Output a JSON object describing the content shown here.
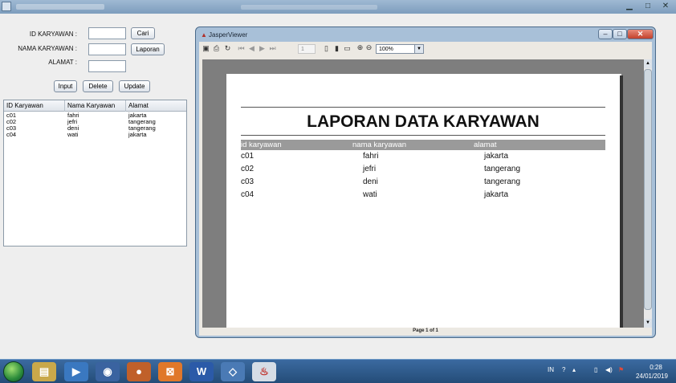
{
  "form": {
    "labels": [
      "ID KARYAWAN :",
      "NAMA KARYAWAN :",
      "ALAMAT :"
    ],
    "cari_label": "Cari",
    "laporan_label": "Laporan",
    "input_label": "Input",
    "delete_label": "Delete",
    "update_label": "Update"
  },
  "table": {
    "headers": [
      "ID Karyawan",
      "Nama Karyawan",
      "Alamat"
    ],
    "rows": [
      [
        "c01",
        "fahri",
        "jakarta"
      ],
      [
        "c02",
        "jefri",
        "tangerang"
      ],
      [
        "c03",
        "deni",
        "tangerang"
      ],
      [
        "c04",
        "wati",
        "jakarta"
      ]
    ]
  },
  "viewer": {
    "title": "JasperViewer",
    "page_input": "1",
    "zoom": "100%",
    "status": "Page 1 of 1",
    "icons": [
      "save-icon",
      "print-icon",
      "reload-icon",
      "first-page-icon",
      "prev-page-icon",
      "next-page-icon",
      "last-page-icon",
      "actual-size-icon",
      "fit-page-icon",
      "fit-width-icon",
      "zoom-in-icon",
      "zoom-out-icon"
    ]
  },
  "report": {
    "title": "LAPORAN DATA KARYAWAN",
    "headers": [
      "id karyawan",
      "nama karyawan",
      "alamat"
    ],
    "rows": [
      [
        "c01",
        "fahri",
        "jakarta"
      ],
      [
        "c02",
        "jefri",
        "tangerang"
      ],
      [
        "c03",
        "deni",
        "tangerang"
      ],
      [
        "c04",
        "wati",
        "jakarta"
      ]
    ]
  },
  "taskbar": {
    "language": "IN",
    "time": "0:28",
    "date": "24/01/2019",
    "pinned": [
      "explorer-icon",
      "media-player-icon",
      "chrome-icon",
      "firefox-icon",
      "xampp-icon",
      "word-icon",
      "virtualbox-icon",
      "java-icon"
    ]
  },
  "colors": {
    "report_header_bg": "#9a9a9a",
    "viewport_bg": "#7e7e7e",
    "taskbar_bg": "#2f5a8c"
  }
}
